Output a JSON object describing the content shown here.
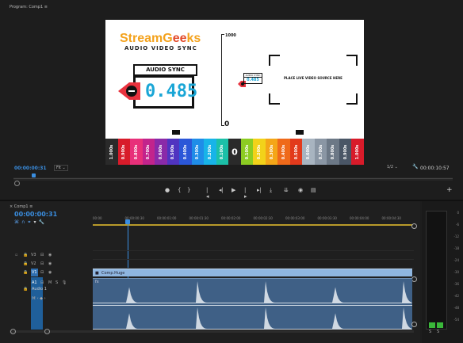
{
  "program": {
    "title": "Program: Comp1",
    "menu_icon": "hamburger-icon"
  },
  "overlay": {
    "logo_part1": "StreamG",
    "logo_part2": "ks",
    "logo_subtitle": "AUDIO VIDEO SYNC",
    "audio_sync_label": "AUDIO SYNC",
    "audio_sync_value": "0.485",
    "meter_top": "1000",
    "meter_bottom": "0",
    "small_label": "AUDIO SYNC",
    "small_value": "0.485",
    "placeholder": "PLACE LIVE VIDEO SOURCE HERE",
    "scale": [
      "1.000s",
      "0.900s",
      "0.800s",
      "0.700s",
      "0.600s",
      "0.500s",
      "0.400s",
      "0.300s",
      "0.200s",
      "0.100s",
      "0",
      "0.100s",
      "0.200s",
      "0.300s",
      "0.400s",
      "0.500s",
      "0.600s",
      "0.700s",
      "0.800s",
      "0.900s",
      "1.000s"
    ],
    "scale_colors": [
      "#2a2a2a",
      "#d81b2a",
      "#e8307a",
      "#c2248c",
      "#8a2aa8",
      "#5034c0",
      "#2b57d8",
      "#1f8de8",
      "#18b4e8",
      "#1cc0a8",
      "#ffffff",
      "#8ccc22",
      "#f2d21a",
      "#f4a618",
      "#ef6a1a",
      "#e23a1c",
      "#a8b4c0",
      "#8a96a4",
      "#6c7886",
      "#4a5666",
      "#d81b2a"
    ]
  },
  "monitor": {
    "timecode": "00:00:00:31",
    "fit": "Fit",
    "resolution": "1/2",
    "duration": "00:00:10:57"
  },
  "controls": [
    "marker-icon",
    "in-point-icon",
    "out-point-icon",
    "go-to-in-icon",
    "step-back-icon",
    "play-icon",
    "step-forward-icon",
    "go-to-out-icon",
    "insert-icon",
    "overwrite-icon",
    "export-frame-icon",
    "button-editor-icon"
  ],
  "control_glyphs": [
    "●",
    "{",
    "}",
    "|◂",
    "◂|",
    "▶",
    "|▸",
    "▸|",
    "⤓",
    "⇊",
    "◉",
    "▤"
  ],
  "add_button": "+",
  "sequence": {
    "tab": "Comp1",
    "timecode": "00:00:00:31",
    "ruler": [
      "00:00",
      "00:00:00:30",
      "00:00:01:00",
      "00:00:01:30",
      "00:00:02:00",
      "00:00:02:30",
      "00:00:03:00",
      "00:00:03:30",
      "00:00:04:00",
      "00:00:04:30"
    ],
    "tracks": [
      {
        "id": "V3",
        "label": ""
      },
      {
        "id": "V2",
        "label": ""
      },
      {
        "id": "V1",
        "label": ""
      },
      {
        "id": "A1",
        "label": "Audio 1"
      }
    ],
    "clip_label": "Comp.Huge",
    "audio_clip_label": "fx"
  },
  "vu_scale": [
    "0",
    "-6",
    "-12",
    "-18",
    "-24",
    "-30",
    "-36",
    "-42",
    "-48",
    "-54"
  ],
  "vu_footer": [
    "S",
    "S"
  ]
}
